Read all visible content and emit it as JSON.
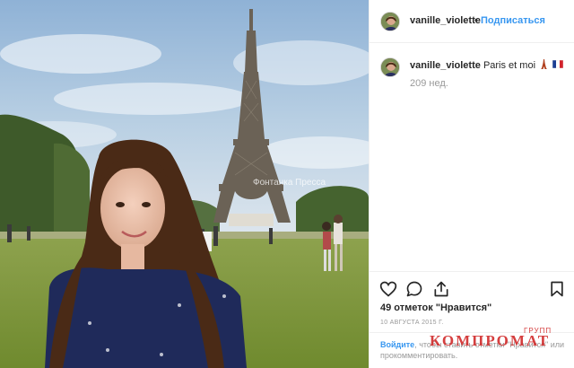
{
  "photo": {
    "alt": "Photo of a woman in front of the Eiffel Tower",
    "watermark": "Фонтанка Пресса"
  },
  "header": {
    "username": "vanille_violette",
    "separator": "•",
    "follow_label": "Подписаться"
  },
  "caption": {
    "username": "vanille_violette",
    "text": "Paris et moi",
    "time": "209 нед."
  },
  "actions": {
    "icons": [
      "heart-icon",
      "comment-icon",
      "share-icon",
      "bookmark-icon"
    ]
  },
  "likes": "49 отметок \"Нравится\"",
  "date": "10 АВГУСТА 2015 Г.",
  "comment_prompt": {
    "login_label": "Войдите",
    "text": ", чтобы ставить отметки \"Нравится\" или прокомментировать."
  },
  "brand": {
    "name": "КОМПРОМАТ",
    "sub": "ГРУПП"
  },
  "colors": {
    "accent": "#3897f0",
    "text": "#262626",
    "muted": "#999999",
    "brand": "#d12b2b"
  }
}
